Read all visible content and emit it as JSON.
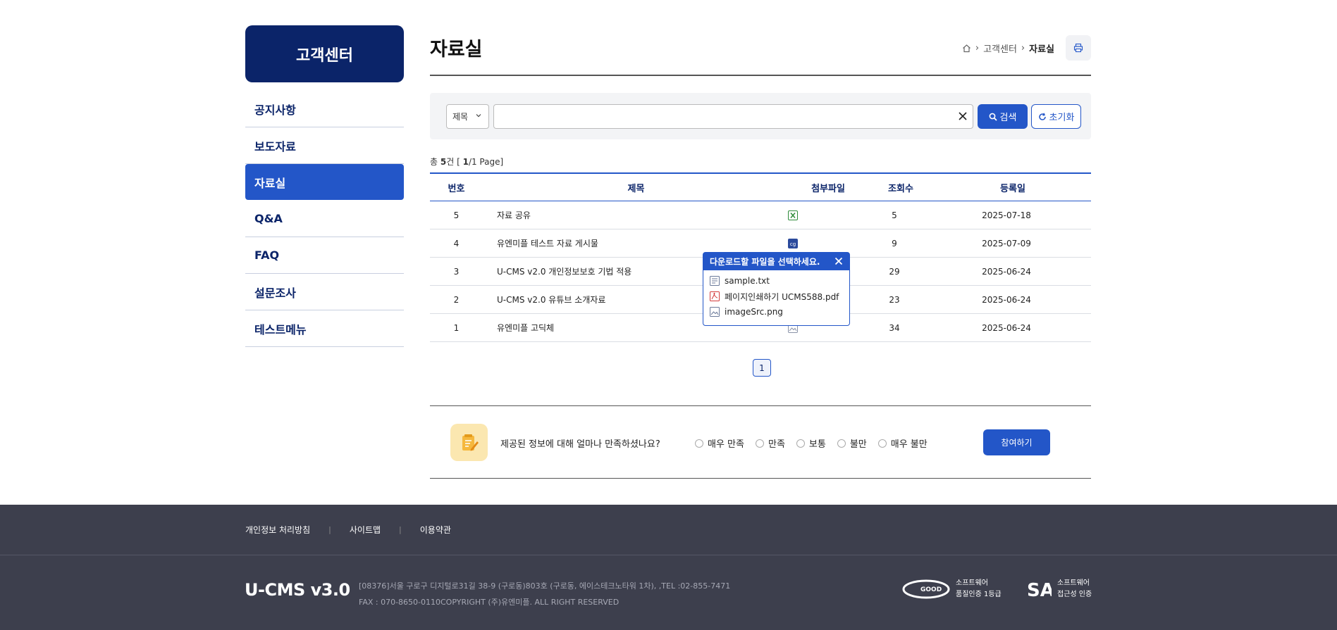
{
  "sidebar": {
    "title": "고객센터",
    "items": [
      {
        "label": "공지사항"
      },
      {
        "label": "보도자료"
      },
      {
        "label": "자료실"
      },
      {
        "label": "Q&A"
      },
      {
        "label": "FAQ"
      },
      {
        "label": "설문조사"
      },
      {
        "label": "테스트메뉴"
      }
    ]
  },
  "header": {
    "title": "자료실",
    "breadcrumb": [
      "고객센터",
      "자료실"
    ]
  },
  "search": {
    "select_value": "제목",
    "input_value": "",
    "search_label": "검색",
    "reset_label": "초기화"
  },
  "total": {
    "prefix": "총 ",
    "count": "5",
    "suffix_count": "건 [ ",
    "page": "1",
    "suffix_page": "/1 Page]"
  },
  "table": {
    "headers": [
      "번호",
      "제목",
      "첨부파일",
      "조회수",
      "등록일"
    ],
    "rows": [
      {
        "num": "5",
        "title": "자료 공유",
        "file": "excel-icon",
        "views": "5",
        "date": "2025-07-18"
      },
      {
        "num": "4",
        "title": "유엔미플 테스트 자료 게시물",
        "file": "multi-file-icon",
        "views": "9",
        "date": "2025-07-09"
      },
      {
        "num": "3",
        "title": "U-CMS v2.0 개인정보보호 기법 적용",
        "file": "",
        "views": "29",
        "date": "2025-06-24"
      },
      {
        "num": "2",
        "title": "U-CMS v2.0 유튜브 소개자료",
        "file": "",
        "views": "23",
        "date": "2025-06-24"
      },
      {
        "num": "1",
        "title": "유엔미플 고딕체",
        "file": "image-icon",
        "views": "34",
        "date": "2025-06-24"
      }
    ]
  },
  "popup": {
    "title": "다운로드할 파일을 선택하세요.",
    "files": [
      {
        "name": "sample.txt",
        "icon": "text-file-icon"
      },
      {
        "name": "페이지인쇄하기 UCMS588.pdf",
        "icon": "pdf-file-icon"
      },
      {
        "name": "imageSrc.png",
        "icon": "image-file-icon"
      }
    ]
  },
  "pagination": {
    "current": "1"
  },
  "survey": {
    "question": "제공된 정보에 대해 얼마나 만족하셨나요?",
    "options": [
      "매우 만족",
      "만족",
      "보통",
      "불만",
      "매우 불만"
    ],
    "submit_label": "참여하기"
  },
  "footer": {
    "links": [
      "개인정보 처리방침",
      "사이트맵",
      "이용약관"
    ],
    "logo": "U-CMS v3.0",
    "address": "[08376]서울 구로구 디지털로31길 38-9 (구로동)803호 (구로동, 에이스테크노타워 1차), ,TEL :02-855-7471",
    "fax": "FAX : 070-8650-0110COPYRIGHT (주)유엔미플. ALL RIGHT RESERVED",
    "cert1": [
      "소프트웨어",
      "품질인증 1등급"
    ],
    "cert2": [
      "소프트웨어",
      "접근성 인증"
    ]
  },
  "colors": {
    "primary": "#2356c8",
    "navy": "#0b2469",
    "footer": "#3d3f4d"
  }
}
